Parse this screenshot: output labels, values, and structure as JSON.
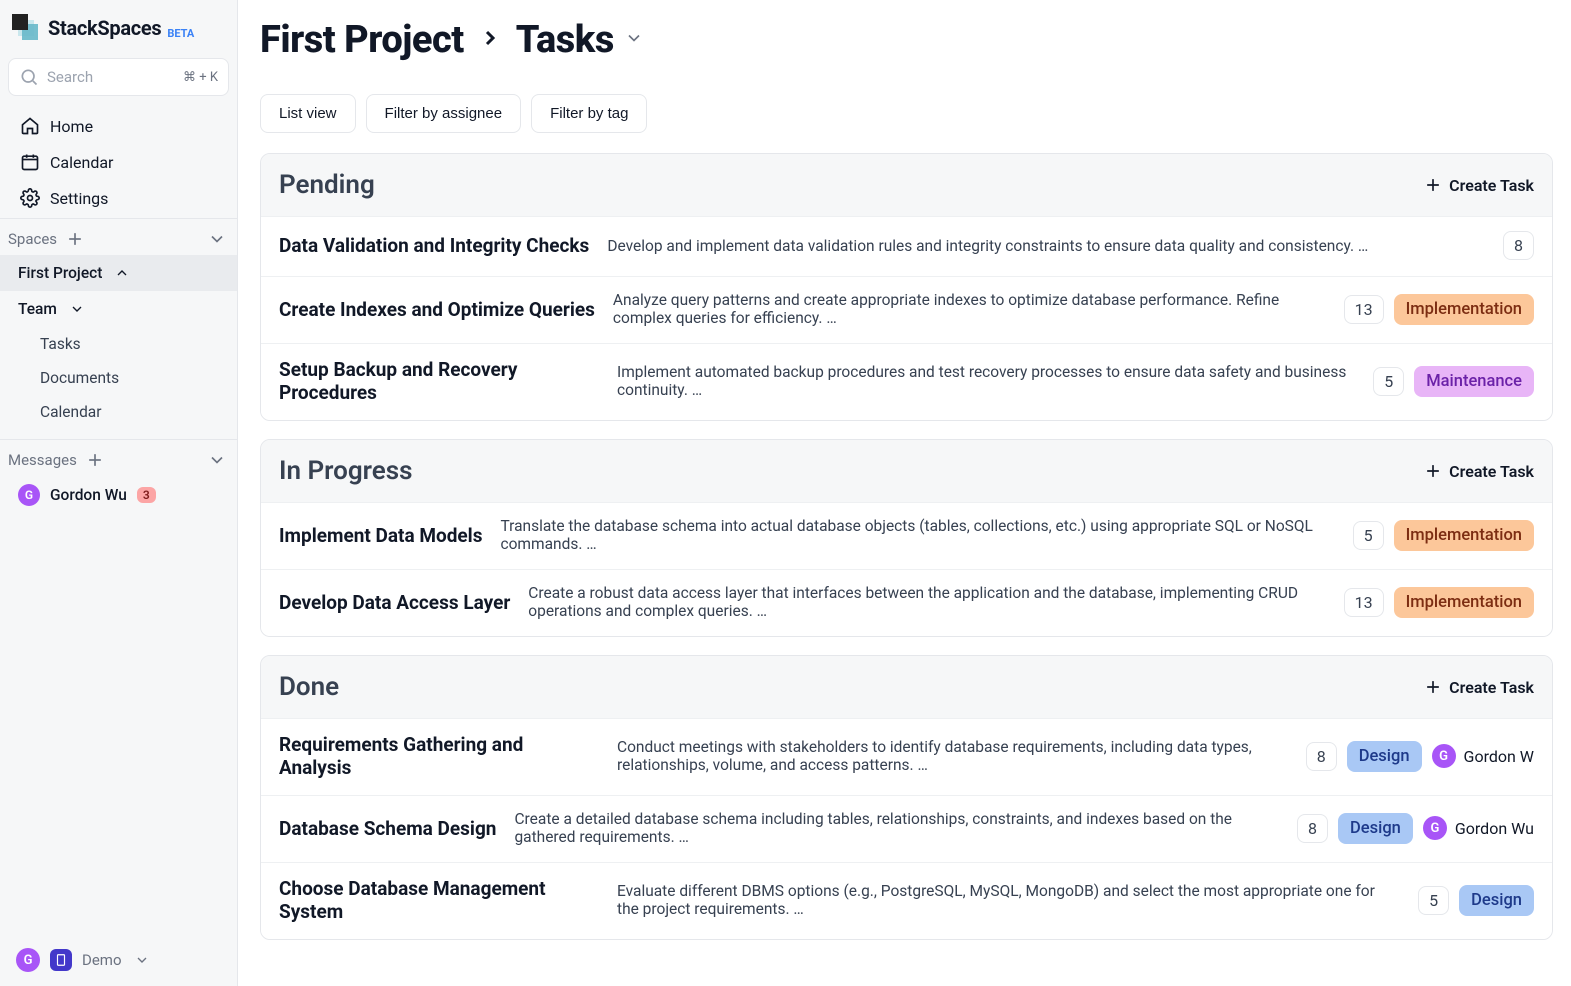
{
  "app": {
    "name": "StackSpaces",
    "beta": "BETA"
  },
  "search": {
    "placeholder": "Search",
    "shortcut": "⌘ + K"
  },
  "nav": {
    "home": "Home",
    "calendar": "Calendar",
    "settings": "Settings"
  },
  "sections": {
    "spaces": {
      "label": "Spaces"
    },
    "messages": {
      "label": "Messages"
    }
  },
  "spaces_tree": {
    "project": "First Project",
    "team": "Team",
    "team_children": {
      "tasks": "Tasks",
      "documents": "Documents",
      "calendar": "Calendar"
    }
  },
  "messages": [
    {
      "initial": "G",
      "name": "Gordon Wu",
      "count": "3"
    }
  ],
  "bottom": {
    "user_initial": "G",
    "workspace_initial": "■",
    "workspace_name": "Demo"
  },
  "breadcrumb": {
    "project": "First Project",
    "section": "Tasks"
  },
  "toolbar": {
    "list_view": "List view",
    "filter_assignee": "Filter by assignee",
    "filter_tag": "Filter by tag"
  },
  "create_task_label": "Create Task",
  "tags": {
    "Implementation": "Implementation",
    "Maintenance": "Maintenance",
    "Design": "Design"
  },
  "groups": [
    {
      "title": "Pending",
      "tasks": [
        {
          "title": "Data Validation and Integrity Checks",
          "desc": "Develop and implement data validation rules and integrity constraints to ensure data quality and consistency. …",
          "points": "8",
          "tag": null,
          "assignee": null
        },
        {
          "title": "Create Indexes and Optimize Queries",
          "desc": "Analyze query patterns and create appropriate indexes to optimize database performance. Refine complex queries for efficiency. …",
          "points": "13",
          "tag": "Implementation",
          "assignee": null
        },
        {
          "title": "Setup Backup and Recovery Procedures",
          "desc": "Implement automated backup procedures and test recovery processes to ensure data safety and business continuity. …",
          "points": "5",
          "tag": "Maintenance",
          "assignee": null
        }
      ]
    },
    {
      "title": "In Progress",
      "tasks": [
        {
          "title": "Implement Data Models",
          "desc": "Translate the database schema into actual database objects (tables, collections, etc.) using appropriate SQL or NoSQL commands. …",
          "points": "5",
          "tag": "Implementation",
          "assignee": null
        },
        {
          "title": "Develop Data Access Layer",
          "desc": "Create a robust data access layer that interfaces between the application and the database, implementing CRUD operations and complex queries. …",
          "points": "13",
          "tag": "Implementation",
          "assignee": null
        }
      ]
    },
    {
      "title": "Done",
      "tasks": [
        {
          "title": "Requirements Gathering and Analysis",
          "desc": "Conduct meetings with stakeholders to identify database requirements, including data types, relationships, volume, and access patterns. …",
          "points": "8",
          "tag": "Design",
          "assignee": {
            "initial": "G",
            "name": "Gordon W"
          }
        },
        {
          "title": "Database Schema Design",
          "desc": "Create a detailed database schema including tables, relationships, constraints, and indexes based on the gathered requirements. …",
          "points": "8",
          "tag": "Design",
          "assignee": {
            "initial": "G",
            "name": "Gordon Wu"
          }
        },
        {
          "title": "Choose Database Management System",
          "desc": "Evaluate different DBMS options (e.g., PostgreSQL, MySQL, MongoDB) and select the most appropriate one for the project requirements. …",
          "points": "5",
          "tag": "Design",
          "assignee": null
        }
      ]
    }
  ]
}
